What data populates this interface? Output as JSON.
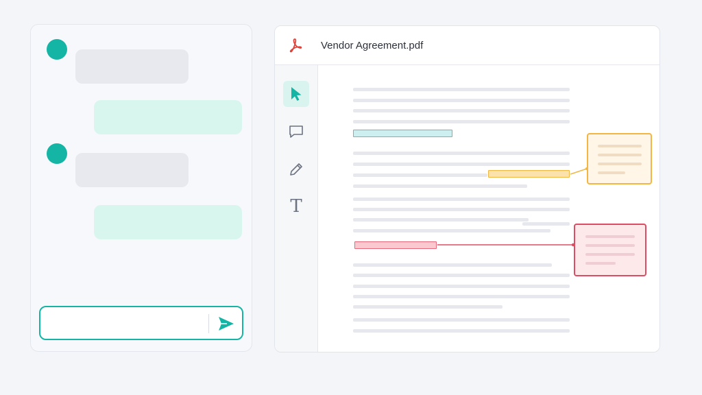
{
  "chat": {
    "input_value": "",
    "send_icon": "send-icon"
  },
  "document": {
    "file_icon": "pdf-icon",
    "title": "Vendor Agreement.pdf"
  },
  "toolbar": {
    "tools": [
      {
        "id": "select",
        "icon": "cursor-arrow-icon",
        "active": true
      },
      {
        "id": "comment",
        "icon": "comment-icon",
        "active": false
      },
      {
        "id": "draw",
        "icon": "pencil-icon",
        "active": false
      },
      {
        "id": "text",
        "icon": "text-icon",
        "glyph": "T",
        "active": false
      }
    ]
  },
  "colors": {
    "accent": "#14b5a5",
    "highlight_teal": "#4cc6c0",
    "highlight_amber": "#f0b843",
    "highlight_red": "#dc4d63",
    "pdf_red": "#e0423a"
  }
}
